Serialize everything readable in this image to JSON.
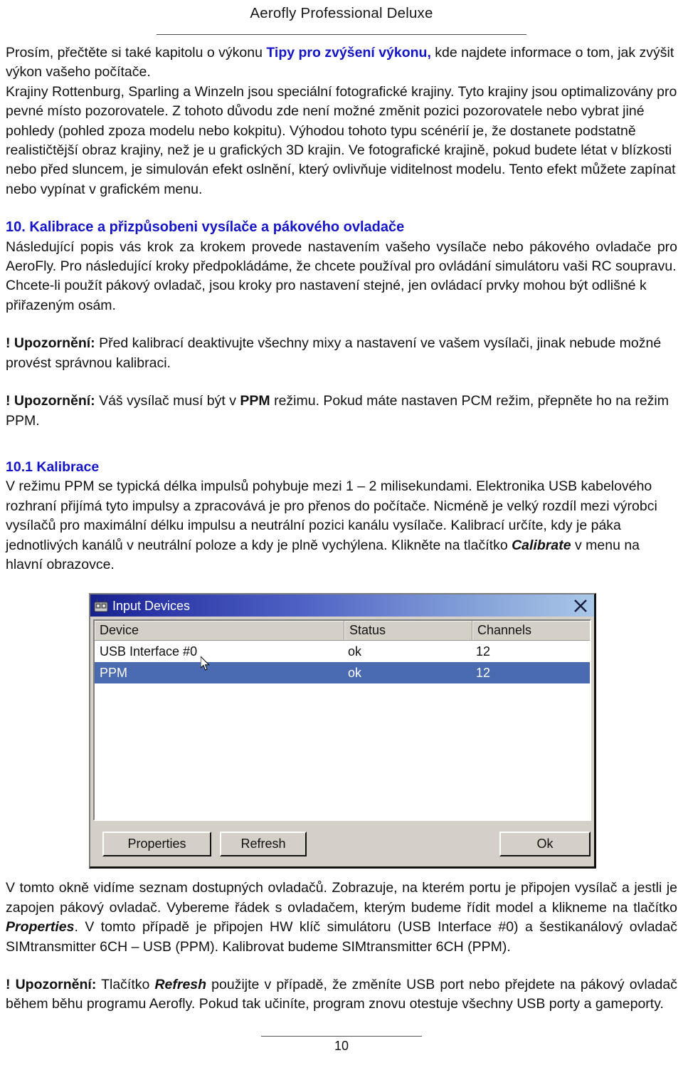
{
  "header": {
    "title": "Aerofly Professional Deluxe"
  },
  "body": {
    "p1_before": "Prosím, přečtěte si také kapitolu o výkonu ",
    "p1_link": "Tipy pro zvýšení výkonu,",
    "p1_after": " kde najdete informace o tom, jak zvýšit výkon vašeho počítače.",
    "p2": "Krajiny Rottenburg, Sparling a Winzeln jsou speciální fotografické krajiny. Tyto krajiny jsou optimalizovány pro pevné místo pozorovatele. Z tohoto důvodu zde není možné změnit pozici pozorovatele nebo vybrat jiné pohledy (pohled zpoza modelu nebo kokpitu). Výhodou tohoto typu scénérií je, že dostanete podstatně realističtější obraz krajiny, než je u grafických 3D krajin. Ve fotografické krajině, pokud budete létat v blízkosti nebo před sluncem, je simulován efekt oslnění, který ovlivňuje viditelnost modelu. Tento efekt můžete zapínat nebo vypínat v grafickém menu.",
    "section10_heading": "10.  Kalibrace a přizpůsobeni vysílače a pákového ovladače",
    "p3": "Následující popis vás krok za krokem provede nastavením vašeho vysílače nebo pákového ovladače pro AeroFly. Pro následující kroky předpokládáme, že chcete používal pro ovládání simulátoru vaši RC soupravu.",
    "p4": "Chcete-li použít pákový ovladač, jsou kroky pro nastavení stejné, jen ovládací prvky mohou být odlišné k přiřazeným osám.",
    "warn1_label": "! Upozornění:",
    "warn1_text": " Před kalibrací deaktivujte všechny mixy a nastavení ve vašem vysílači, jinak nebude možné provést správnou kalibraci.",
    "warn2_label": "! Upozornění:",
    "warn2_a": " Váš vysílač musí být v ",
    "warn2_bold": "PPM",
    "warn2_b": " režimu. Pokud máte nastaven PCM režim, přepněte ho na režim PPM.",
    "section101_heading": "10.1 Kalibrace",
    "p5_a": "V režimu PPM se typická délka impulsů pohybuje mezi 1 – 2 milisekundami. Elektronika USB kabelového rozhraní přijímá tyto impulsy a zpracovává je pro přenos do počítače. Nicméně je velký rozdíl mezi výrobci vysílačů pro maximální délku impulsu a neutrální pozici kanálu vysílače. Kalibrací určíte, kdy je páka jednotlivých kanálů v neutrální poloze a kdy je plně vychýlena. Klikněte na tlačítko ",
    "p5_bold": "Calibrate",
    "p5_b": " v menu na hlavní obrazovce.",
    "p6_a": "V tomto okně vidíme seznam dostupných ovladačů. Zobrazuje, na kterém portu je připojen vysílač a jestli je zapojen pákový ovladač. Vybereme řádek s ovladačem, kterým budeme řídit model a klikneme na tlačítko ",
    "p6_bold": "Properties",
    "p6_b": ". V tomto případě je připojen HW klíč simulátoru (USB Interface #0) a šestikanálový ovladač SIMtransmitter 6CH – USB (PPM). Kalibrovat budeme SIMtransmitter 6CH (PPM).",
    "warn3_label": "! Upozornění:",
    "warn3_a": " Tlačítko ",
    "warn3_bold": "Refresh",
    "warn3_b": " použijte v případě, že změníte USB port nebo přejdete na pákový ovladač během běhu programu Aerofly. Pokud tak učiníte, program znovu otestuje všechny USB porty a gameporty."
  },
  "dialog": {
    "title": "Input Devices",
    "icon": "rc-transmitter-icon",
    "close_icon": "close-icon",
    "columns": [
      "Device",
      "Status",
      "Channels"
    ],
    "rows": [
      {
        "device": "USB Interface #0",
        "status": "ok",
        "channels": "12",
        "selected": false
      },
      {
        "device": "PPM",
        "status": "ok",
        "channels": "12",
        "selected": true
      }
    ],
    "buttons": {
      "properties": "Properties",
      "refresh": "Refresh",
      "ok": "Ok"
    },
    "colors": {
      "titlebar_start": "#16218c",
      "titlebar_end": "#a9c8e8",
      "selection": "#4a6bb0",
      "face": "#d4d0c8"
    }
  },
  "footer": {
    "page_number": "10"
  }
}
